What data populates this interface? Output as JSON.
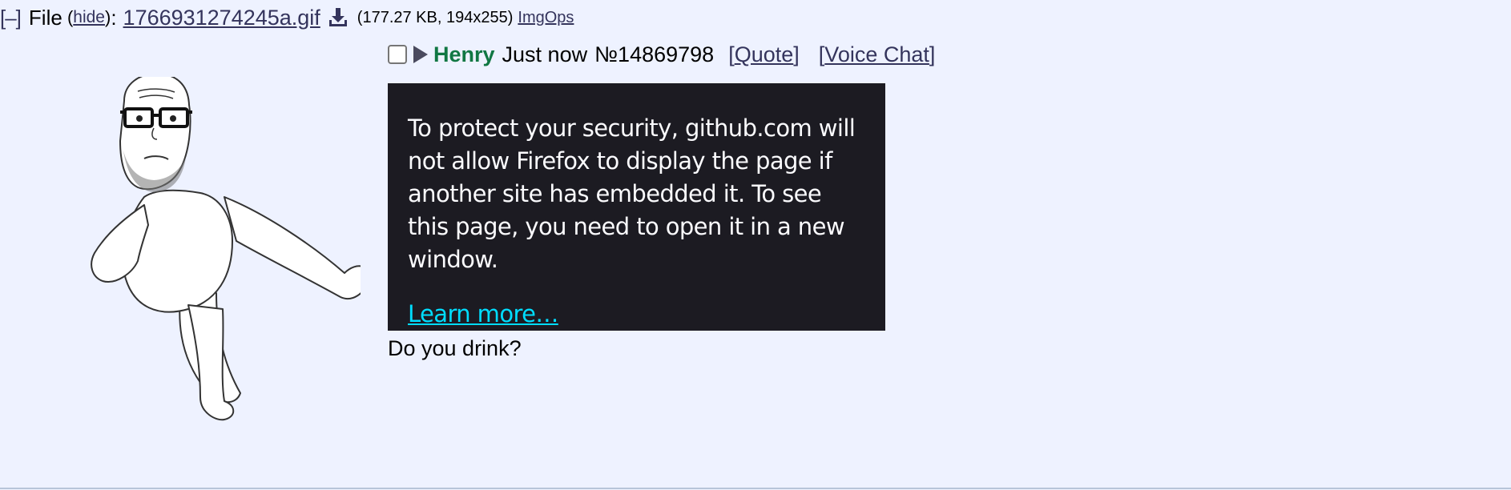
{
  "file_info": {
    "collapse_label": "[–]",
    "file_label": "File",
    "hide_label": "hide",
    "filename": "1766931274245a.gif",
    "meta": "(177.27 KB, 194x255)",
    "imgops_label": "ImgOps"
  },
  "post": {
    "name": "Henry",
    "time": "Just now",
    "number": "№14869798",
    "quote_label": "Quote",
    "voice_chat_label": "Voice Chat",
    "message": "Do you drink?"
  },
  "embed": {
    "message": "To protect your security, github.com will not allow Firefox to display the page if another site has embedded it. To see this page, you need to open it in a new window.",
    "learn_more": "Learn more…"
  },
  "colors": {
    "background": "#eef2ff",
    "name_green": "#117743",
    "link": "#34345c",
    "embed_bg": "#1c1b22",
    "embed_link": "#00ddff"
  },
  "icons": {
    "download": "download-icon",
    "menu": "triangle-right-icon"
  }
}
